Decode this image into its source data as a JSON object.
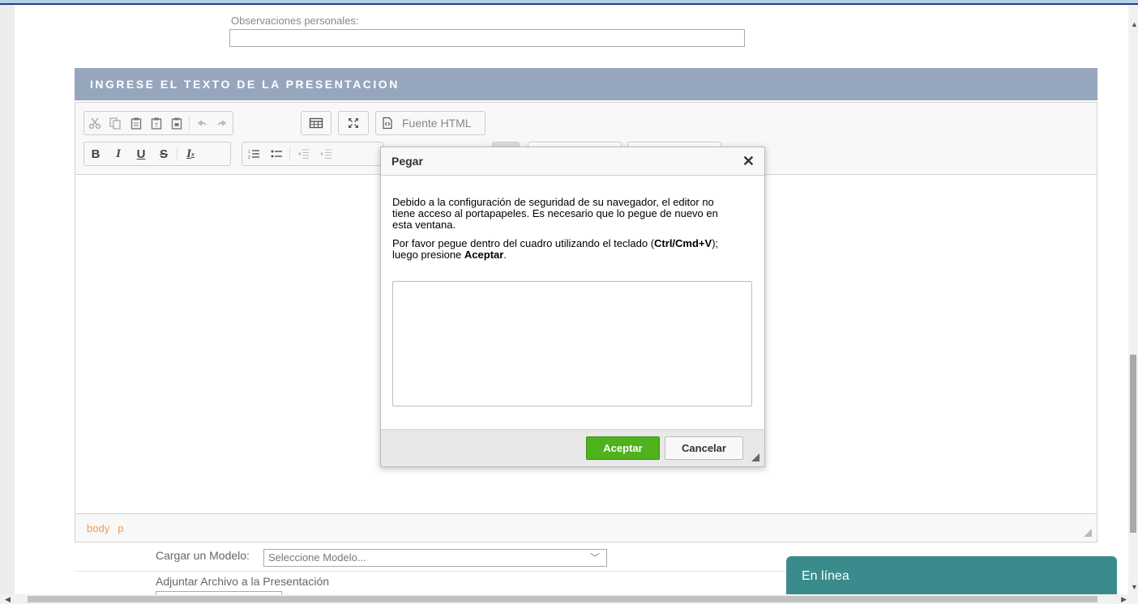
{
  "form": {
    "observations_label": "Observaciones personales:",
    "observations_value": ""
  },
  "section": {
    "title": "INGRESE EL TEXTO DE LA PRESENTACION"
  },
  "toolbar": {
    "row1": {
      "icons": [
        "cut-icon",
        "copy-icon",
        "paste-icon",
        "paste-text-icon",
        "paste-word-icon",
        "undo-icon",
        "redo-icon",
        "table-icon",
        "maximize-icon",
        "source-icon"
      ],
      "source_label": "Fuente HTML"
    },
    "row2": {
      "icons": [
        "bold-icon",
        "italic-icon",
        "underline-icon",
        "strike-icon",
        "remove-format-icon",
        "numbered-list-icon",
        "bulleted-list-icon",
        "outdent-icon",
        "indent-icon"
      ]
    }
  },
  "statusbar": {
    "path": [
      "body",
      "p"
    ]
  },
  "dialog": {
    "title": "Pegar",
    "paragraph1": "Debido a la configuración de seguridad de su navegador, el editor no tiene acceso al portapapeles. Es necesario que lo pegue de nuevo en esta ventana.",
    "paragraph2_prefix": "Por favor pegue dentro del cuadro utilizando el teclado (",
    "paragraph2_shortcut": "Ctrl/Cmd+V",
    "paragraph2_middle": "); luego presione ",
    "paragraph2_action": "Aceptar",
    "paragraph2_suffix": ".",
    "paste_area_value": "",
    "ok_label": "Aceptar",
    "cancel_label": "Cancelar"
  },
  "model": {
    "label": "Cargar un Modelo:",
    "select_value": "Seleccione Modelo..."
  },
  "attach": {
    "label": "Adjuntar Archivo a la Presentación"
  },
  "chat": {
    "status": "En línea"
  },
  "colors": {
    "section_header": "#96a6bd",
    "accept_button": "#4fb11c",
    "chat_widget": "#3a8c8c",
    "path_link": "#f39b4a"
  }
}
